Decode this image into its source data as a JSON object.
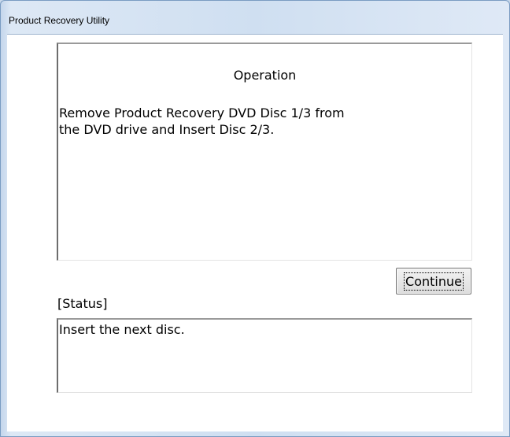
{
  "window": {
    "title": "Product Recovery Utility"
  },
  "operation": {
    "heading": "Operation",
    "message_line1": "Remove Product Recovery DVD Disc 1/3 from",
    "message_line2": "the DVD drive and Insert Disc 2/3."
  },
  "actions": {
    "continue_label": "Continue"
  },
  "status": {
    "label": "[Status]",
    "message": "Insert the next disc."
  }
}
